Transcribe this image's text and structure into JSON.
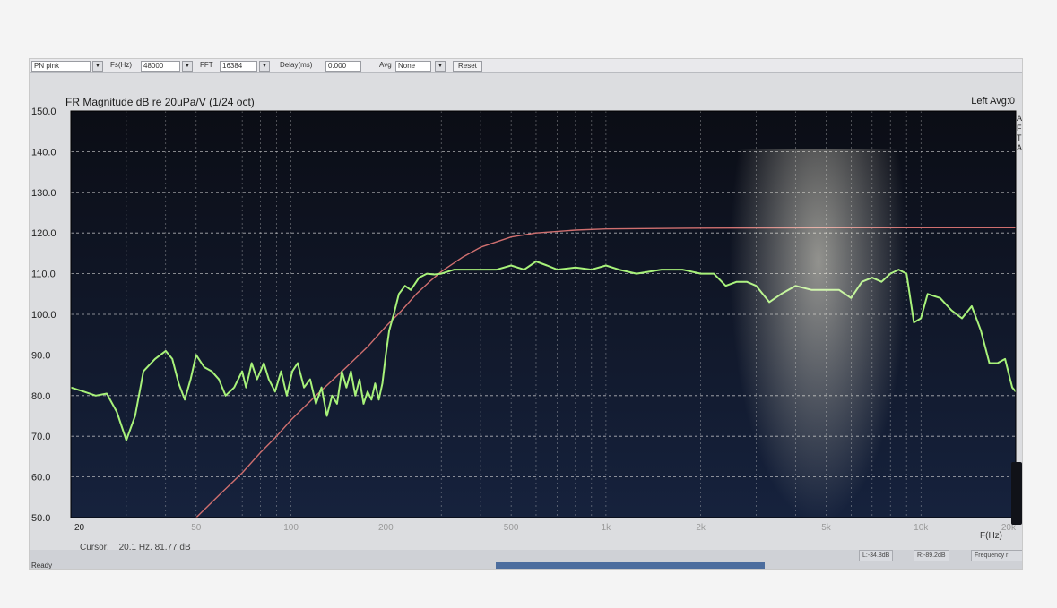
{
  "toolbar": {
    "signal_value": "PN pink",
    "fs_label": "Fs(Hz)",
    "fs_value": "48000",
    "fft_label": "FFT",
    "fft_value": "16384",
    "delay_label": "Delay(ms)",
    "delay_value": "0.000",
    "avg_label": "Avg",
    "avg_value": "None",
    "reset_label": "Reset"
  },
  "chart_data": {
    "type": "line",
    "title": "FR Magnitude dB re 20uPa/V (1/24 oct)",
    "channel_label": "Left  Avg:0",
    "xlabel": "F(Hz)",
    "xscale": "log",
    "xlim": [
      20,
      20000
    ],
    "ylim": [
      50,
      150
    ],
    "grid": true,
    "y_ticks": [
      "150.0",
      "140.0",
      "130.0",
      "120.0",
      "110.0",
      "100.0",
      "90.0",
      "80.0",
      "70.0",
      "60.0",
      "50.0"
    ],
    "x_ticks": [
      {
        "value": 20,
        "label": "20"
      },
      {
        "value": 50,
        "label": "50"
      },
      {
        "value": 100,
        "label": "100"
      },
      {
        "value": 200,
        "label": "200"
      },
      {
        "value": 500,
        "label": "500"
      },
      {
        "value": 1000,
        "label": "1k"
      },
      {
        "value": 2000,
        "label": "2k"
      },
      {
        "value": 5000,
        "label": "5k"
      },
      {
        "value": 10000,
        "label": "10k"
      },
      {
        "value": 20000,
        "label": "20k"
      }
    ],
    "series": [
      {
        "color": "#a8f27a",
        "points": [
          [
            20,
            82
          ],
          [
            22,
            81
          ],
          [
            24,
            80
          ],
          [
            26,
            80.5
          ],
          [
            28,
            76
          ],
          [
            30,
            69
          ],
          [
            32,
            75
          ],
          [
            34,
            86
          ],
          [
            37,
            89
          ],
          [
            40,
            91
          ],
          [
            42,
            89
          ],
          [
            44,
            83
          ],
          [
            46,
            79
          ],
          [
            48,
            84
          ],
          [
            50,
            90
          ],
          [
            53,
            87
          ],
          [
            56,
            86
          ],
          [
            59,
            84
          ],
          [
            62,
            80
          ],
          [
            66,
            82
          ],
          [
            70,
            86
          ],
          [
            72,
            82
          ],
          [
            75,
            88
          ],
          [
            78,
            84
          ],
          [
            82,
            88
          ],
          [
            85,
            84
          ],
          [
            89,
            81
          ],
          [
            93,
            86
          ],
          [
            97,
            80
          ],
          [
            101,
            86
          ],
          [
            105,
            88
          ],
          [
            110,
            82
          ],
          [
            115,
            84
          ],
          [
            120,
            78
          ],
          [
            125,
            82
          ],
          [
            130,
            75
          ],
          [
            135,
            80
          ],
          [
            140,
            78
          ],
          [
            145,
            86
          ],
          [
            150,
            82
          ],
          [
            155,
            86
          ],
          [
            160,
            80
          ],
          [
            165,
            84
          ],
          [
            170,
            78
          ],
          [
            175,
            81
          ],
          [
            180,
            79
          ],
          [
            185,
            83
          ],
          [
            190,
            79
          ],
          [
            195,
            83
          ],
          [
            200,
            90
          ],
          [
            205,
            96
          ],
          [
            212,
            100
          ],
          [
            220,
            105
          ],
          [
            230,
            107
          ],
          [
            240,
            106
          ],
          [
            255,
            109
          ],
          [
            270,
            110
          ],
          [
            285,
            109.8
          ],
          [
            300,
            110
          ],
          [
            330,
            111
          ],
          [
            360,
            111
          ],
          [
            400,
            111
          ],
          [
            450,
            111
          ],
          [
            500,
            112
          ],
          [
            550,
            111
          ],
          [
            600,
            113
          ],
          [
            650,
            112
          ],
          [
            700,
            111
          ],
          [
            800,
            111.5
          ],
          [
            900,
            111
          ],
          [
            1000,
            112
          ],
          [
            1100,
            111
          ],
          [
            1250,
            110
          ],
          [
            1500,
            111
          ],
          [
            1750,
            111
          ],
          [
            2000,
            110
          ],
          [
            2200,
            110
          ],
          [
            2400,
            107
          ],
          [
            2600,
            108
          ],
          [
            2800,
            108
          ],
          [
            3000,
            107
          ],
          [
            3300,
            103
          ],
          [
            3600,
            105
          ],
          [
            4000,
            107
          ],
          [
            4500,
            106
          ],
          [
            5000,
            106
          ],
          [
            5500,
            106
          ],
          [
            6000,
            104
          ],
          [
            6500,
            108
          ],
          [
            7000,
            109
          ],
          [
            7500,
            108
          ],
          [
            8000,
            110
          ],
          [
            8500,
            111
          ],
          [
            9000,
            110
          ],
          [
            9500,
            98
          ],
          [
            10000,
            99
          ],
          [
            10500,
            105
          ],
          [
            11500,
            104
          ],
          [
            12500,
            101
          ],
          [
            13500,
            99
          ],
          [
            14500,
            102
          ],
          [
            15500,
            96
          ],
          [
            16500,
            88
          ],
          [
            17500,
            88
          ],
          [
            18500,
            89
          ],
          [
            19500,
            82
          ],
          [
            20000,
            81
          ]
        ]
      },
      {
        "color": "#cf6f6f",
        "points": [
          [
            50,
            50
          ],
          [
            60,
            56
          ],
          [
            70,
            61
          ],
          [
            80,
            66
          ],
          [
            90,
            70
          ],
          [
            100,
            74
          ],
          [
            120,
            80
          ],
          [
            150,
            87
          ],
          [
            175,
            92
          ],
          [
            200,
            97
          ],
          [
            225,
            101
          ],
          [
            250,
            105
          ],
          [
            275,
            108
          ],
          [
            300,
            110.5
          ],
          [
            350,
            114
          ],
          [
            400,
            116.5
          ],
          [
            500,
            119
          ],
          [
            600,
            120
          ],
          [
            800,
            120.7
          ],
          [
            1000,
            121
          ],
          [
            2000,
            121.2
          ],
          [
            5000,
            121.3
          ],
          [
            10000,
            121.3
          ],
          [
            20000,
            121.3
          ]
        ]
      }
    ]
  },
  "cursor": {
    "label": "Cursor:",
    "value": "20.1 Hz, 81.77 dB"
  },
  "statusbar": {
    "ready": "Ready",
    "left_level": "L:-34.8dB",
    "right_level": "R:-89.2dB",
    "mode": "Frequency r"
  },
  "colors": {
    "plot_background": "#0b0d15",
    "grid": "#d8d8d8",
    "trace_measured": "#a8f27a",
    "trace_target": "#cf6f6f"
  }
}
